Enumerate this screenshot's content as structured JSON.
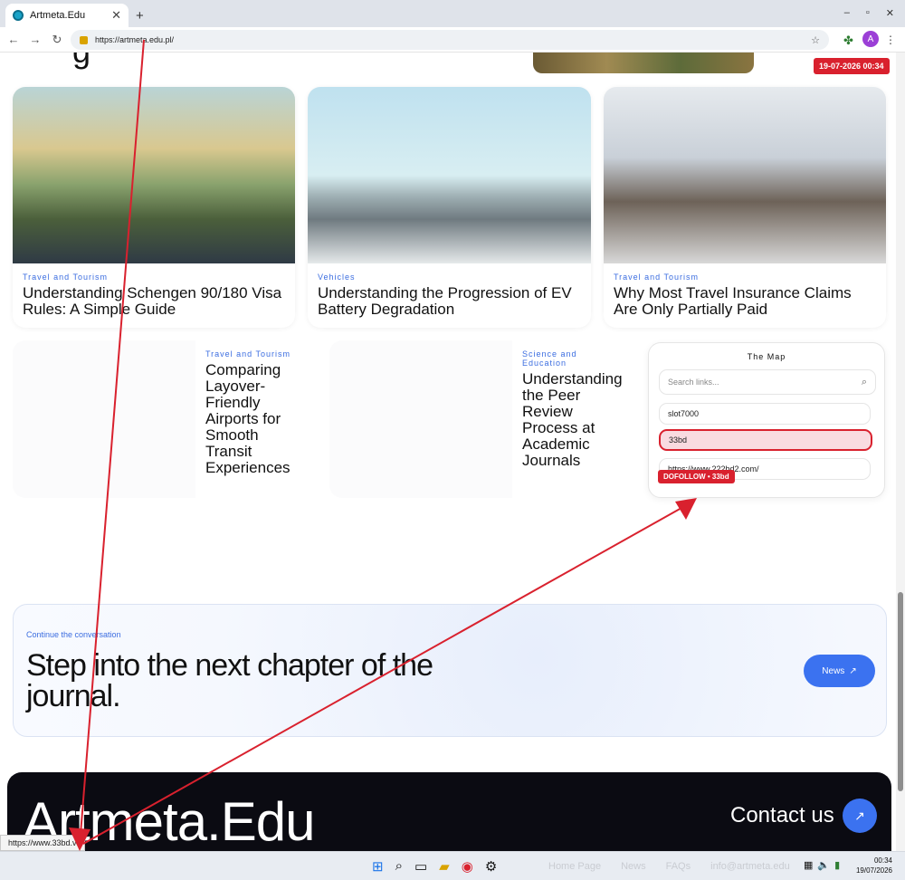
{
  "browser": {
    "tab_title": "Artmeta.Edu",
    "url": "https://artmeta.edu.pl/",
    "new_tab_glyph": "+",
    "close_glyph": "✕",
    "avatar_letter": "A"
  },
  "page": {
    "date_badge": "19-07-2026 00:34",
    "heading_fragment": "g",
    "cards": [
      {
        "category": "Travel and Tourism",
        "title": "Understanding Schengen 90/180 Visa Rules: A Simple Guide"
      },
      {
        "category": "Vehicles",
        "title": "Understanding the Progression of EV Battery Degradation"
      },
      {
        "category": "Travel and Tourism",
        "title": "Why Most Travel Insurance Claims Are Only Partially Paid"
      }
    ],
    "cards_row2": [
      {
        "category": "Travel and Tourism",
        "title": "Comparing Layover-Friendly Airports for Smooth Transit Experiences"
      },
      {
        "category": "Science and Education",
        "title": "Understanding the Peer Review Process at Academic Journals"
      }
    ],
    "map": {
      "title": "The Map",
      "search_placeholder": "Search links...",
      "links": [
        "slot7000",
        "33bd",
        "https://www.222bd2.com/"
      ],
      "dofollow_badge": "DOFOLLOW • 33bd"
    },
    "cta": {
      "kicker": "Continue the conversation",
      "headline": "Step into the next chapter of the journal.",
      "button": "News",
      "button_arrow": "↗"
    },
    "footer": {
      "brand": "Artmeta.Edu",
      "contact": "Contact us",
      "contact_arrow": "↗"
    },
    "status_url": "https://www.33bd.v"
  },
  "taskbar": {
    "links": [
      "Home Page",
      "News",
      "FAQs",
      "info@artmeta.edu"
    ],
    "time": "00:34",
    "date": "19/07/2026"
  },
  "icons": {
    "back": "back-arrow-icon",
    "forward": "forward-arrow-icon",
    "reload": "reload-icon",
    "bookmark": "star-icon",
    "extension": "extension-icon",
    "search": "magnifier-icon"
  },
  "colors": {
    "accent": "#3b72f0",
    "badge_red": "#d9212e",
    "category_blue": "#3b6de0",
    "footer_bg": "#0b0b12"
  }
}
